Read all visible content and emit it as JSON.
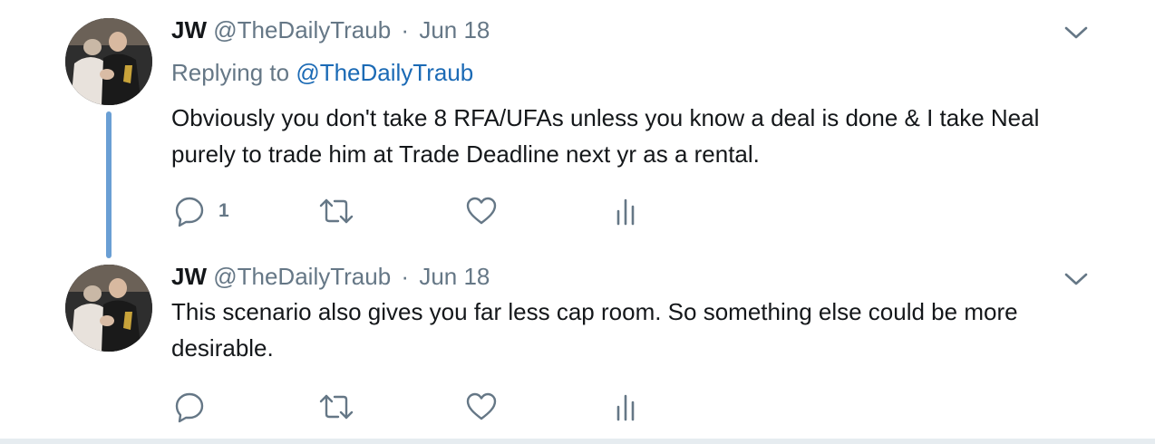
{
  "tweets": [
    {
      "author_name": "JW",
      "author_handle": "@TheDailyTraub",
      "separator": "·",
      "date": "Jun 18",
      "replying_prefix": "Replying to",
      "replying_handle": "@TheDailyTraub",
      "text": "Obviously you don't take 8 RFA/UFAs unless you know a deal is done & I take Neal purely to trade him at Trade Deadline next yr as a rental.",
      "reply_count": "1",
      "icons": [
        "reply-icon",
        "retweet-icon",
        "like-icon",
        "analytics-icon",
        "chevron-down-icon"
      ]
    },
    {
      "author_name": "JW",
      "author_handle": "@TheDailyTraub",
      "separator": "·",
      "date": "Jun 18",
      "text": "This scenario also gives you far less cap room. So something else could be more desirable.",
      "reply_count": "",
      "icons": [
        "reply-icon",
        "retweet-icon",
        "like-icon",
        "analytics-icon",
        "chevron-down-icon"
      ]
    }
  ],
  "colors": {
    "text": "#14171a",
    "muted": "#657786",
    "link": "#1b6ab5",
    "thread_line": "#6a9fd4",
    "divider": "#e6ecf0"
  }
}
